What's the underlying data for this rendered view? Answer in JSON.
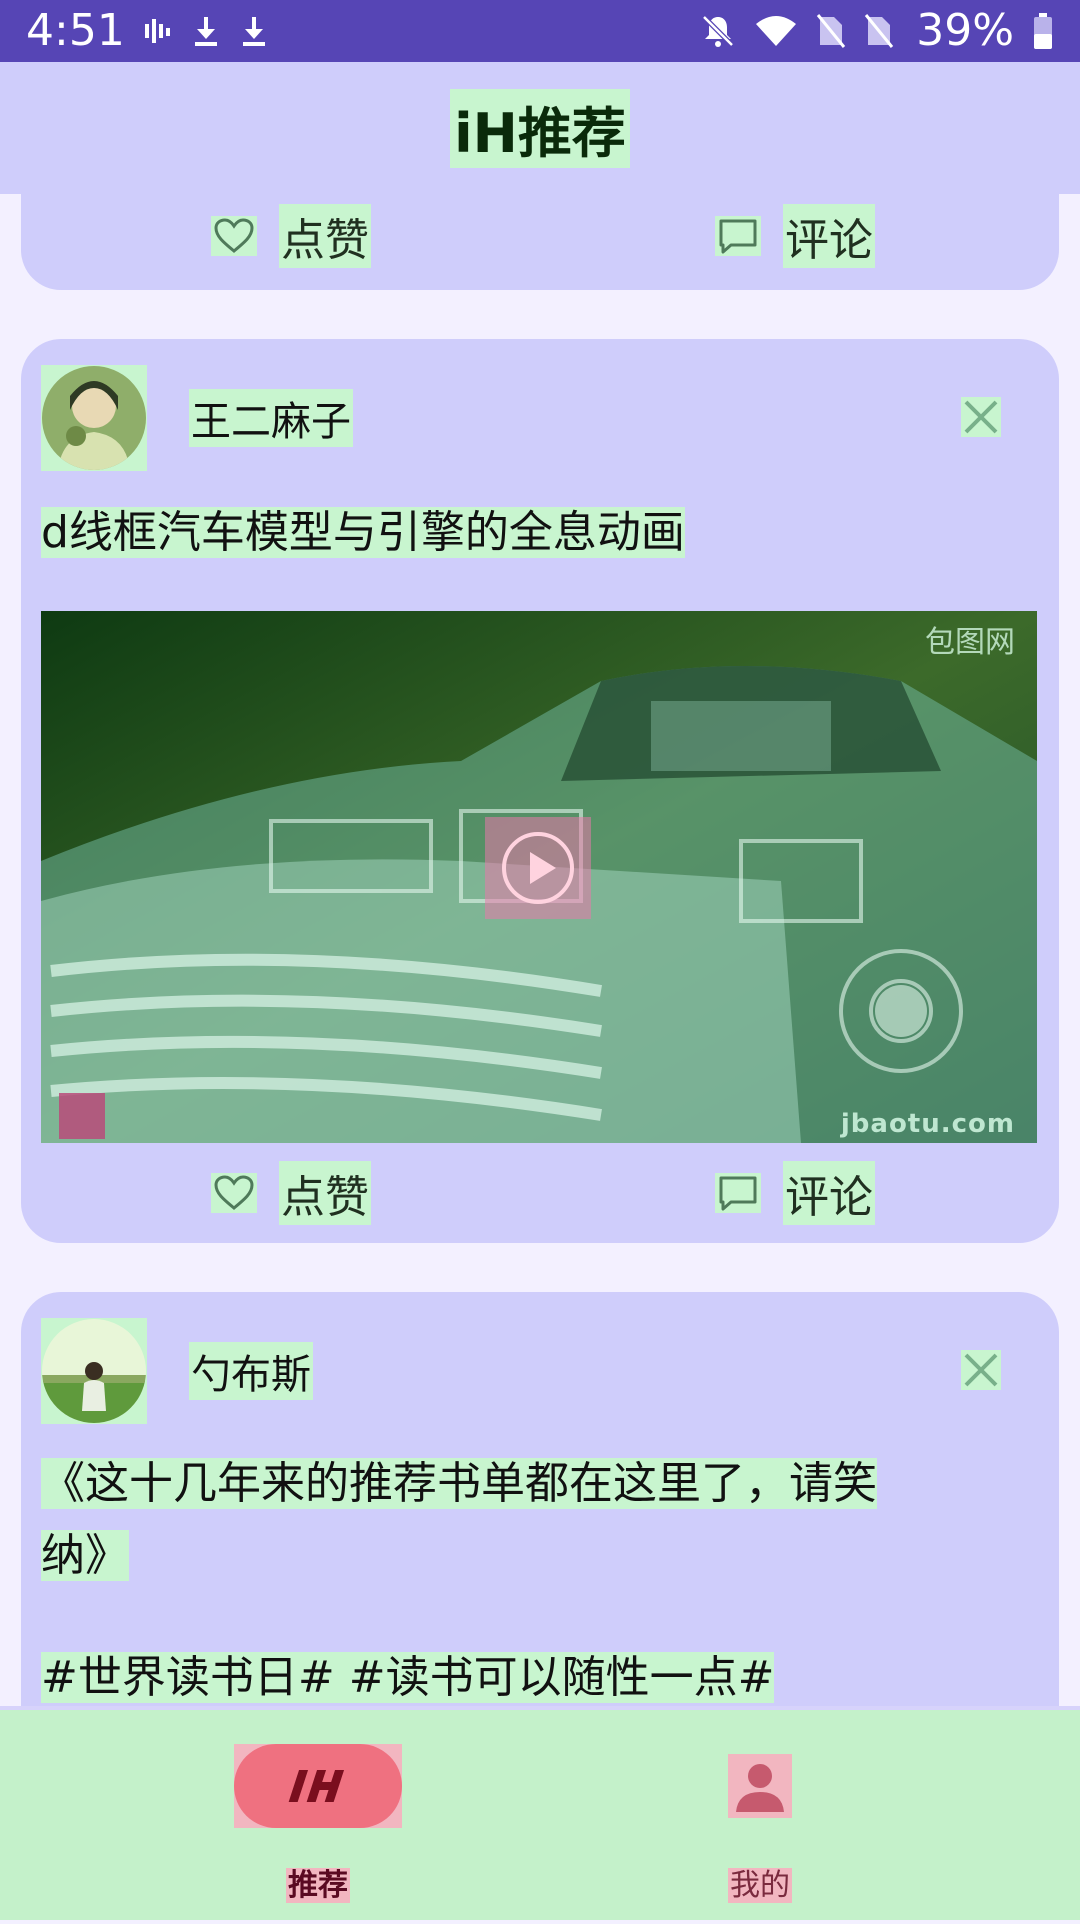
{
  "status_bar": {
    "time": "4:51",
    "battery_percent": "39%",
    "icons": [
      "activity-icon",
      "download-icon",
      "download-icon",
      "bell-off-icon",
      "wifi-icon",
      "no-sim-icon",
      "no-sim-icon",
      "battery-icon"
    ]
  },
  "app_bar": {
    "title": "iH推荐"
  },
  "feed": {
    "posts": [
      {
        "actions": {
          "like_label": "点赞",
          "comment_label": "评论"
        }
      },
      {
        "author": "王二麻子",
        "text": "d线框汽车模型与引擎的全息动画",
        "video": {
          "watermark_top": "包图网",
          "watermark_bottom": "jbaotu.com"
        },
        "actions": {
          "like_label": "点赞",
          "comment_label": "评论"
        }
      },
      {
        "author": "勺布斯",
        "text_line1": "《这十几年来的推荐书单都在这里了，请笑",
        "text_line2": "纳》",
        "tags": "#世界读书日# #读书可以随性一点#"
      }
    ]
  },
  "bottom_nav": {
    "items": [
      {
        "label": "推荐",
        "icon": "ih-logo-icon",
        "selected": true
      },
      {
        "label": "我的",
        "icon": "person-icon",
        "selected": false
      }
    ]
  },
  "colors": {
    "status_bar": "#5645b5",
    "card": "#cfcdfb",
    "highlight": "#c8f5cf",
    "nav_bg": "#c4f1ca",
    "accent": "#ef7180"
  }
}
